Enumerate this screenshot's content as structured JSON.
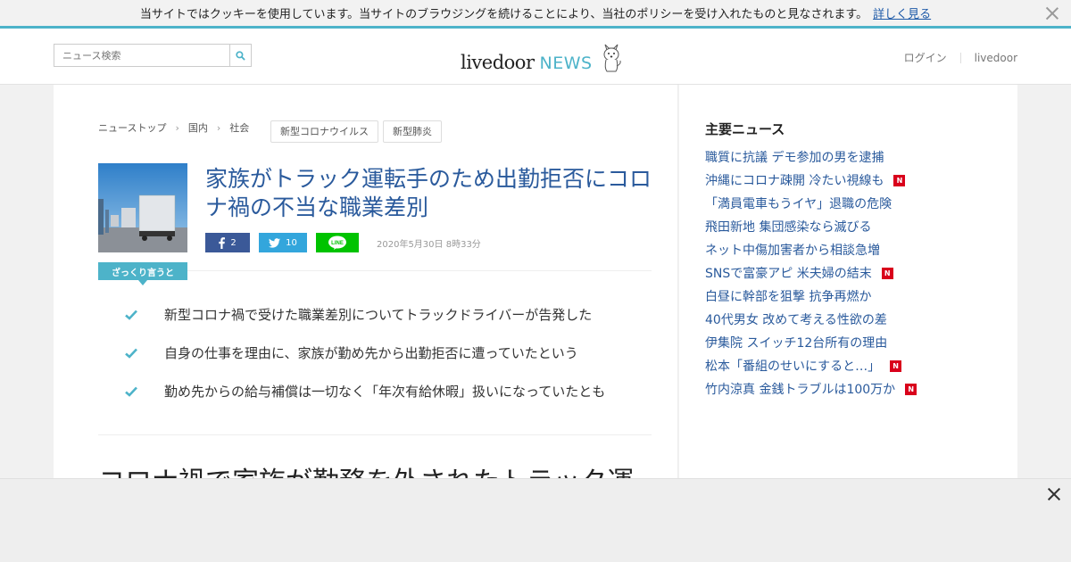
{
  "cookie": {
    "message": "当サイトではクッキーを使用しています。当サイトのブラウジングを続けることにより、当社のポリシーを受け入れたものと見なされます。",
    "link_label": "詳しく見る"
  },
  "header": {
    "search_placeholder": "ニュース検索",
    "logo_main": "livedoor",
    "logo_news": "NEWS",
    "login_label": "ログイン",
    "livedoor_label": "livedoor"
  },
  "breadcrumb": [
    "ニューストップ",
    "国内",
    "社会"
  ],
  "tags": [
    "新型コロナウイルス",
    "新型肺炎"
  ],
  "article": {
    "title": "家族がトラック運転手のため出勤拒否にコロナ禍の不当な職業差別",
    "facebook_count": "2",
    "twitter_count": "10",
    "line_label": "LINE",
    "date": "2020年5月30日 8時33分",
    "summary_label": "ざっくり言うと",
    "summary": [
      "新型コロナ禍で受けた職業差別についてトラックドライバーが告発した",
      "自身の仕事を理由に、家族が勤め先から出勤拒否に遭っていたという",
      "勤め先からの給与補償は一切なく「年次有給休暇」扱いになっていたとも"
    ],
    "body_heading": "コロナ禍で家族が勤務を外されたトラック運"
  },
  "sidebar": {
    "title": "主要ニュース",
    "badge_label": "N",
    "items": [
      {
        "label": "職質に抗議 デモ参加の男を逮捕",
        "new": false
      },
      {
        "label": "沖縄にコロナ疎開 冷たい視線も",
        "new": true
      },
      {
        "label": "「満員電車もうイヤ」退職の危険",
        "new": false
      },
      {
        "label": "飛田新地 集団感染なら滅びる",
        "new": false
      },
      {
        "label": "ネット中傷加害者から相談急増",
        "new": false
      },
      {
        "label": "SNSで富豪アピ 米夫婦の結末",
        "new": true
      },
      {
        "label": "白昼に幹部を狙撃 抗争再燃か",
        "new": false
      },
      {
        "label": "40代男女 改めて考える性欲の差",
        "new": false
      },
      {
        "label": "伊集院 スイッチ12台所有の理由",
        "new": false
      },
      {
        "label": "松本「番組のせいにすると…」",
        "new": true
      },
      {
        "label": "竹内涼真 金銭トラブルは100万か",
        "new": true
      }
    ]
  },
  "colors": {
    "accent": "#4db3c9",
    "link": "#2a5a9c",
    "facebook": "#3b5998",
    "twitter": "#33a6dc",
    "line": "#00c300",
    "badge": "#d9001b"
  },
  "icons": {
    "search": "search-icon",
    "dog": "dog-mascot-icon",
    "check": "check-icon",
    "close": "close-icon"
  }
}
